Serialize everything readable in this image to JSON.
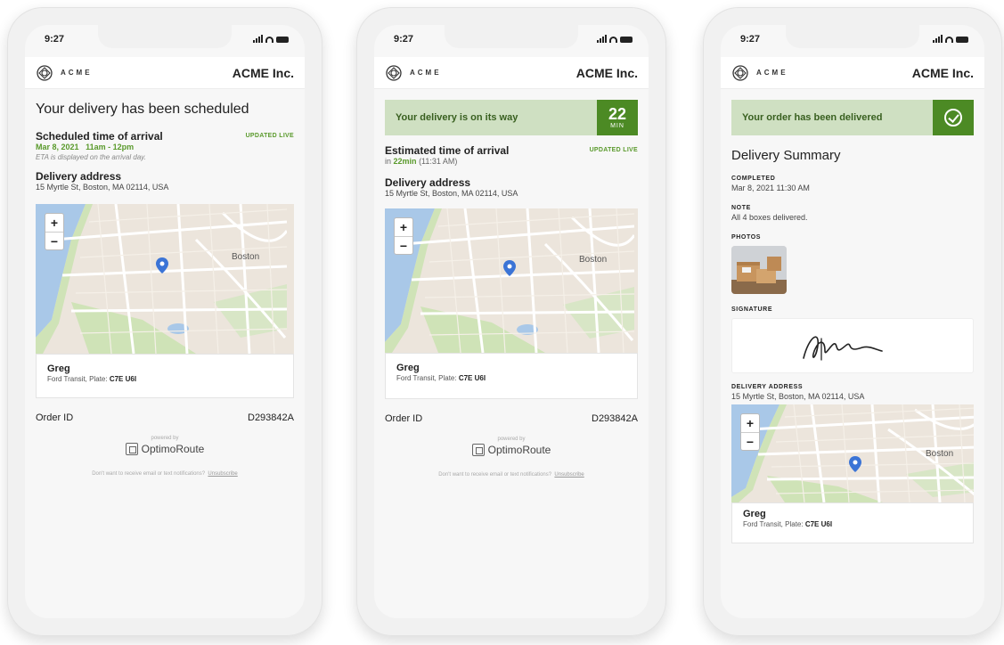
{
  "colors": {
    "accent_green": "#4c8a24",
    "banner_green": "#cfe0c2",
    "live_green": "#5a9a2c"
  },
  "status": {
    "time": "9:27"
  },
  "brand": {
    "logo_text": "ACME",
    "company": "ACME Inc.",
    "logo_icon": "acme-logo-icon"
  },
  "phone1": {
    "title": "Your delivery has been scheduled",
    "sched_label": "Scheduled time of arrival",
    "updated": "UPDATED LIVE",
    "sched_date": "Mar 8, 2021",
    "sched_window": "11am - 12pm",
    "eta_note": "ETA is displayed on the arrival day.",
    "address_label": "Delivery address",
    "address": "15 Myrtle St, Boston, MA 02114, USA",
    "map_label": "Boston",
    "driver_name": "Greg",
    "vehicle": "Ford Transit, Plate:",
    "plate": "C7E U6I",
    "order_label": "Order ID",
    "order_id": "D293842A",
    "powered_by": "powered by",
    "optimo": "OptimoRoute",
    "unsub_text": "Don't want to receive email or text notifications?",
    "unsub_link": "Unsubscribe"
  },
  "phone2": {
    "banner": "Your delivery is on its way",
    "minutes": "22",
    "minutes_unit": "MIN",
    "eta_label": "Estimated time of arrival",
    "updated": "UPDATED LIVE",
    "eta_in": "in",
    "eta_min": "22min",
    "eta_time": "(11:31 AM)",
    "address_label": "Delivery address",
    "address": "15 Myrtle St, Boston, MA 02114, USA",
    "map_label": "Boston",
    "driver_name": "Greg",
    "vehicle": "Ford Transit, Plate:",
    "plate": "C7E U6I",
    "order_label": "Order ID",
    "order_id": "D293842A",
    "powered_by": "powered by",
    "optimo": "OptimoRoute",
    "unsub_text": "Don't want to receive email or text notifications?",
    "unsub_link": "Unsubscribe"
  },
  "phone3": {
    "banner": "Your order has been delivered",
    "summary_title": "Delivery Summary",
    "completed_label": "COMPLETED",
    "completed_value": "Mar 8, 2021 11:30 AM",
    "note_label": "NOTE",
    "note_value": "All 4 boxes delivered.",
    "photos_label": "PHOTOS",
    "signature_label": "SIGNATURE",
    "address_label": "DELIVERY ADDRESS",
    "address": "15 Myrtle St, Boston, MA 02114, USA",
    "map_label": "Boston",
    "driver_name": "Greg",
    "vehicle": "Ford Transit, Plate:",
    "plate": "C7E U6I"
  }
}
